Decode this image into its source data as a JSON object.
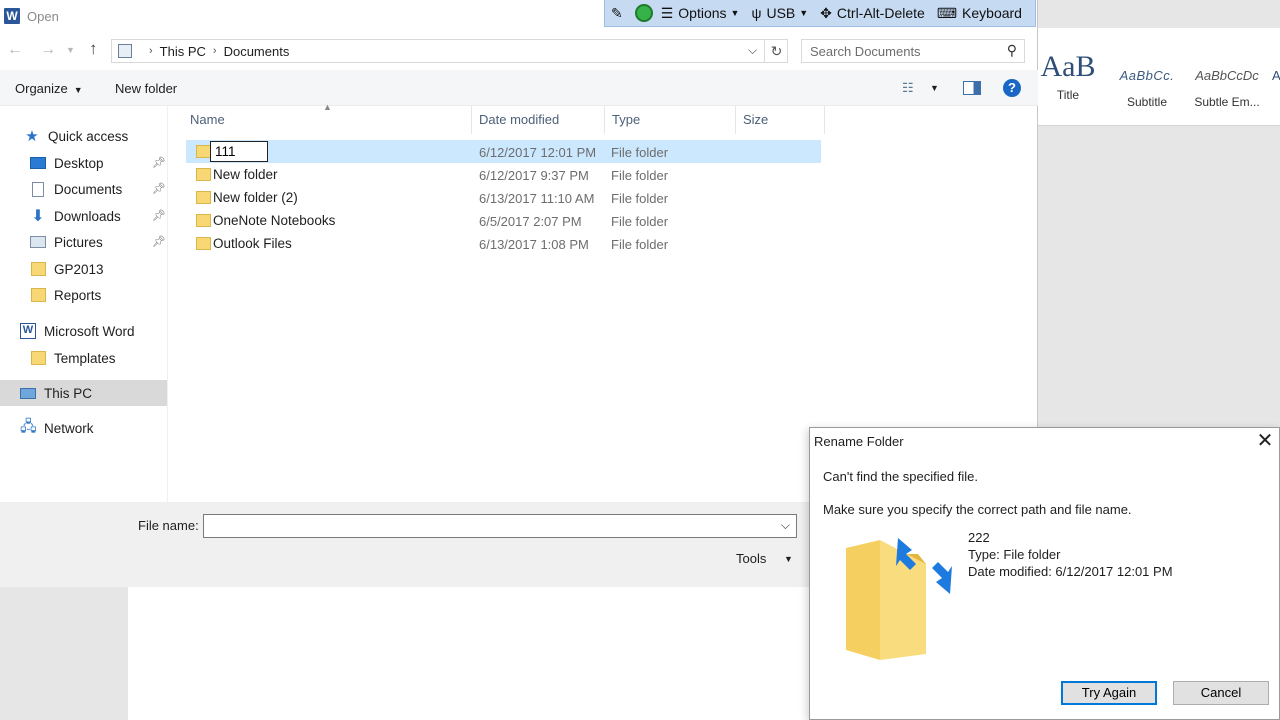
{
  "open_dialog": {
    "title": "Open",
    "app_icon_letter": "W"
  },
  "remote_toolbar": {
    "options_label": "Options",
    "usb_label": "USB",
    "ctrl_alt_delete_label": "Ctrl-Alt-Delete",
    "keyboard_label": "Keyboard"
  },
  "address": {
    "crumbs": [
      "This PC",
      "Documents"
    ],
    "search_placeholder": "Search Documents"
  },
  "command_bar": {
    "organize_label": "Organize",
    "new_folder_label": "New folder"
  },
  "nav_pane": {
    "quick_access": "Quick access",
    "items": [
      {
        "label": "Desktop",
        "pinned": true
      },
      {
        "label": "Documents",
        "pinned": true
      },
      {
        "label": "Downloads",
        "pinned": true
      },
      {
        "label": "Pictures",
        "pinned": true
      },
      {
        "label": "GP2013"
      },
      {
        "label": "Reports"
      }
    ],
    "microsoft_word": "Microsoft Word",
    "templates": "Templates",
    "this_pc": "This PC",
    "network": "Network"
  },
  "file_list": {
    "columns": {
      "name": "Name",
      "date": "Date modified",
      "type": "Type",
      "size": "Size"
    },
    "rows": [
      {
        "name": "111",
        "date": "6/12/2017 12:01 PM",
        "type": "File folder",
        "editing": true
      },
      {
        "name": "New folder",
        "date": "6/12/2017 9:37 PM",
        "type": "File folder"
      },
      {
        "name": "New folder (2)",
        "date": "6/13/2017 11:10 AM",
        "type": "File folder"
      },
      {
        "name": "OneNote Notebooks",
        "date": "6/5/2017 2:07 PM",
        "type": "File folder"
      },
      {
        "name": "Outlook Files",
        "date": "6/13/2017 1:08 PM",
        "type": "File folder"
      }
    ]
  },
  "bottom": {
    "file_name_label": "File name:",
    "file_name_value": "",
    "tools_label": "Tools"
  },
  "word_ribbon": {
    "styles": [
      {
        "preview": "AaB",
        "label": "Title"
      },
      {
        "preview": "AaBbCc.",
        "label": "Subtitle"
      },
      {
        "preview": "AaBbCcDc",
        "label": "Subtle Em..."
      },
      {
        "preview": "A",
        "label": ""
      }
    ]
  },
  "rename_dialog": {
    "title": "Rename Folder",
    "message": "Can't find the specified file.",
    "hint": "Make sure you specify the correct path and file name.",
    "folder_name": "222",
    "folder_type": "Type: File folder",
    "folder_date": "Date modified: 6/12/2017 12:01 PM",
    "try_again_label": "Try Again",
    "cancel_label": "Cancel"
  },
  "colors": {
    "accent": "#0078d7",
    "selection": "#cce8ff",
    "folder": "#f8d775",
    "toolbar": "#c6daf2"
  }
}
